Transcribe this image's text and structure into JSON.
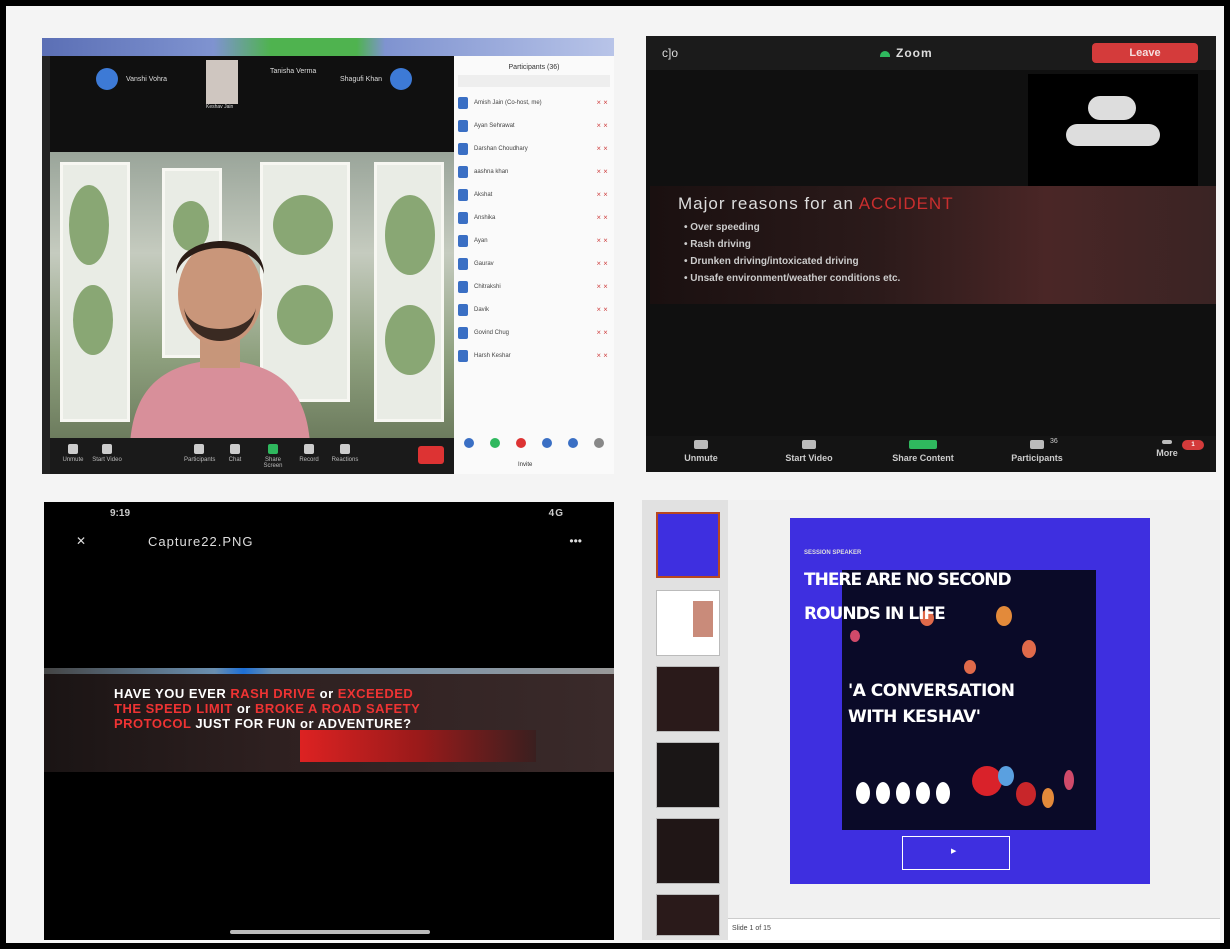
{
  "panel_gallery": {
    "thumbnails": [
      {
        "name": "Vanshi Vohra"
      },
      {
        "name": "Keshav Jain"
      },
      {
        "name": "Tanisha Verma"
      },
      {
        "name": "Shagufi Khan"
      }
    ],
    "participants_title": "Participants (36)",
    "participants": [
      "Amish Jain (Co-host, me)",
      "Ayan Sehrawat",
      "Darshan Choudhary",
      "aashna khan",
      "Akshat",
      "Anshika",
      "Ayan",
      "Gaurav",
      "Chitrakshi",
      "Davik",
      "Govind Chug",
      "Harsh Keshar"
    ],
    "invite_label": "Invite",
    "controls": [
      "Unmute",
      "Start Video",
      "Participants",
      "Chat",
      "Share Screen",
      "Record",
      "Reactions"
    ]
  },
  "panel_share": {
    "app_name": "Zoom",
    "logo": "c]o",
    "leave_label": "Leave",
    "slide_heading_prefix": "Major reasons for an",
    "slide_heading_accent": "ACCIDENT",
    "bullets": [
      "Over speeding",
      "Rash driving",
      "Drunken driving/intoxicated driving",
      "Unsafe environment/weather conditions etc."
    ],
    "controls": [
      "Unmute",
      "Start Video",
      "Share Content",
      "Participants",
      "More"
    ],
    "participant_count": "36",
    "more_badge": "1"
  },
  "panel_phone": {
    "status_time": "9:19",
    "status_right": "4G",
    "title": "Capture22.PNG",
    "banner_prefix": "HAVE YOU EVER",
    "banner_red_1": "RASH DRIVE",
    "banner_mid": "or",
    "banner_red_2": "EXCEEDED THE SPEED LIMIT",
    "banner_mid_2": "or",
    "banner_red_3": "BROKE A ROAD SAFETY PROTOCOL",
    "banner_suffix": "JUST FOR FUN or ADVENTURE?"
  },
  "panel_slides": {
    "kicker": "SESSION SPEAKER",
    "title_line1": "THERE ARE NO SECOND",
    "title_line2": "ROUNDS IN LIFE",
    "quote_line1": "'A CONVERSATION",
    "quote_line2": "WITH KESHAV'",
    "button_text": "",
    "notes_label": "Slide 1 of 15"
  }
}
